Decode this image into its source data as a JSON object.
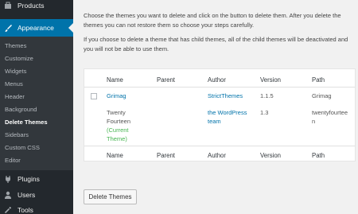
{
  "sidebar": {
    "products": "Products",
    "appearance": "Appearance",
    "submenu": [
      "Themes",
      "Customize",
      "Widgets",
      "Menus",
      "Header",
      "Background",
      "Delete Themes",
      "Sidebars",
      "Custom CSS",
      "Editor"
    ],
    "current": "Delete Themes",
    "plugins": "Plugins",
    "users": "Users",
    "tools": "Tools"
  },
  "intro": {
    "p1": "Choose the themes you want to delete and click on the button to delete them. After you delete the themes you can not restore them so choose your steps carefully.",
    "p2": "If you choose to delete a theme that has child themes, all of the child themes will be deactivated and you will not be able to use them."
  },
  "table": {
    "headers": [
      "Name",
      "Parent",
      "Author",
      "Version",
      "Path"
    ],
    "rows": [
      {
        "name": "Grimag",
        "parent": "",
        "author": "StrictThemes",
        "version": "1.1.5",
        "path": "Grimag",
        "checkbox": true
      },
      {
        "name_line1": "Twenty",
        "name_line2": "Fourteen",
        "status_line1": "(Current",
        "status_line2": "Theme)",
        "parent": "",
        "author_line1": "the WordPress",
        "author_line2": "team",
        "version": "1.3",
        "path_line1": "twentyfourtee",
        "path_line2": "n",
        "checkbox": false
      }
    ]
  },
  "button_label": "Delete Themes",
  "colors": {
    "sidebar_bg": "#23282d",
    "active_bg": "#0073aa",
    "link": "#0073aa",
    "current_theme": "#46b450"
  }
}
